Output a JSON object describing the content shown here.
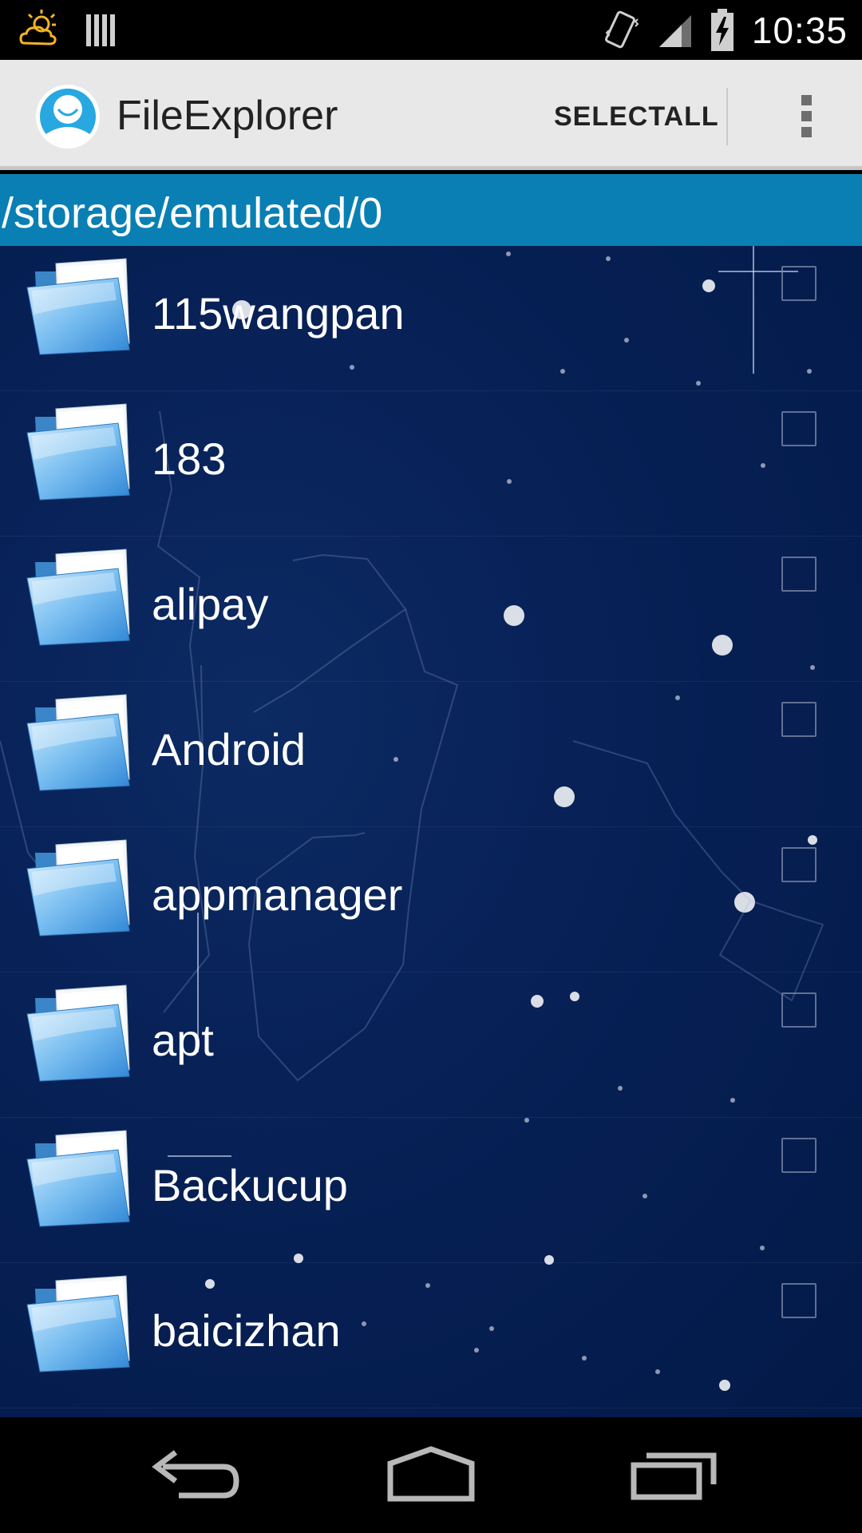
{
  "status_bar": {
    "time": "10:35",
    "icons": [
      "weather-sun-cloud-icon",
      "storage-bars-icon",
      "vibrate-icon",
      "signal-icon",
      "battery-charging-icon"
    ]
  },
  "action_bar": {
    "title": "FileExplorer",
    "select_all_label": "SELECTALL",
    "app_icon": "smiling-user-icon",
    "overflow_icon": "overflow-menu-icon"
  },
  "path": {
    "current": "/storage/emulated/0"
  },
  "files": [
    {
      "name": "115wangpan",
      "type": "folder",
      "checked": false
    },
    {
      "name": "183",
      "type": "folder",
      "checked": false
    },
    {
      "name": "alipay",
      "type": "folder",
      "checked": false
    },
    {
      "name": "Android",
      "type": "folder",
      "checked": false
    },
    {
      "name": "appmanager",
      "type": "folder",
      "checked": false
    },
    {
      "name": "apt",
      "type": "folder",
      "checked": false
    },
    {
      "name": "Backucup",
      "type": "folder",
      "checked": false
    },
    {
      "name": "baicizhan",
      "type": "folder",
      "checked": false
    }
  ],
  "nav_bar": {
    "buttons": [
      "back-icon",
      "home-icon",
      "recent-apps-icon"
    ]
  },
  "colors": {
    "path_bar": "#0a7fb4",
    "list_bg": "#072055",
    "action_bar": "#e8e8e8"
  }
}
